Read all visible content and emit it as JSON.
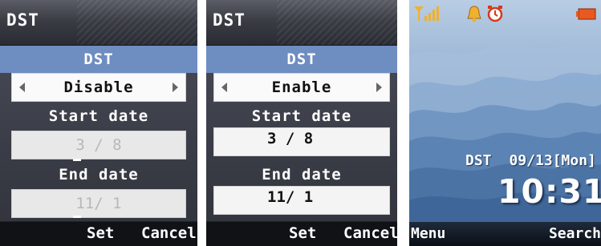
{
  "screen1": {
    "title": "DST",
    "dst_label": "DST",
    "dst_value": "Disable",
    "start_label": "Start date",
    "start_value": "3 / 8",
    "end_label": "End date",
    "end_value": "11/ 1",
    "softkey_left": "Set",
    "softkey_right": "Cancel"
  },
  "screen2": {
    "title": "DST",
    "dst_label": "DST",
    "dst_value": "Enable",
    "start_label": "Start date",
    "start_value": "3 / 8",
    "end_label": "End date",
    "end_value": "11/ 1",
    "softkey_left": "Set",
    "softkey_right": "Cancel"
  },
  "home": {
    "status_icons": [
      "signal-icon",
      "bell-icon",
      "alarm-clock-icon",
      "battery-icon"
    ],
    "dst_indicator": "DST",
    "date": "09/13[Mon]",
    "time": "10:31",
    "softkey_left": "Menu",
    "softkey_right": "Search"
  },
  "colors": {
    "highlight": "#6e8dc1",
    "battery": "#e85a1f",
    "status_icon": "#f0b030"
  }
}
